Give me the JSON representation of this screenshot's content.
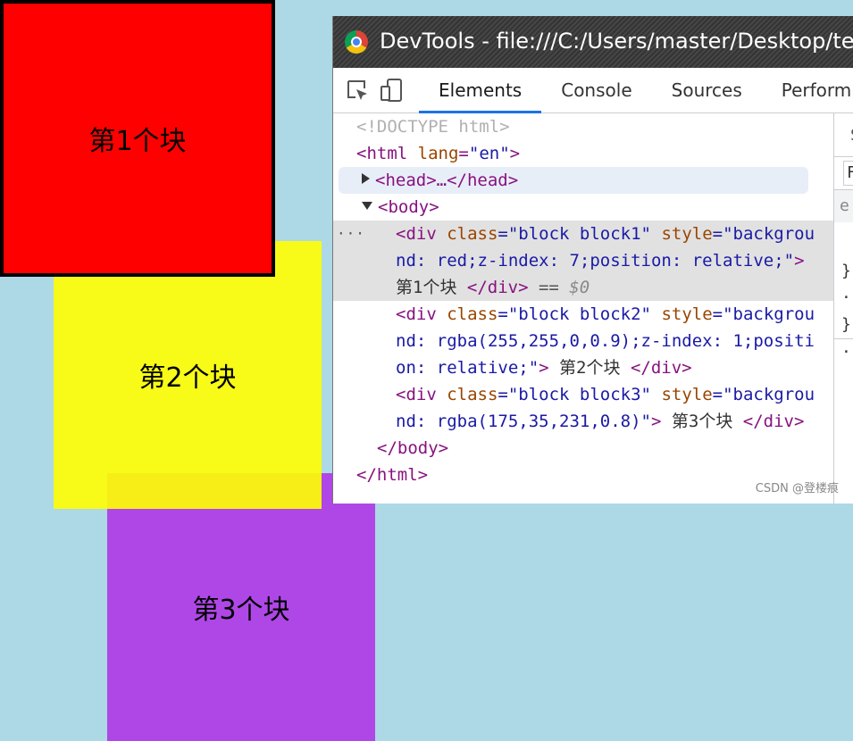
{
  "page": {
    "blocks": [
      {
        "label": "第1个块",
        "color": "#ff0000"
      },
      {
        "label": "第2个块",
        "color": "rgba(255,255,0,0.9)"
      },
      {
        "label": "第3个块",
        "color": "rgba(175,35,231,0.8)"
      }
    ]
  },
  "devtools": {
    "title": "DevTools - file:///C:/Users/master/Desktop/tes",
    "toolbar": {
      "inspect_icon": "inspect-element-icon",
      "device_icon": "device-toolbar-icon"
    },
    "tabs": [
      "Elements",
      "Console",
      "Sources",
      "Perform"
    ],
    "active_tab": "Elements",
    "dom": {
      "doctype": "<!DOCTYPE html>",
      "html_open_tag": "<html",
      "html_attr": "lang",
      "html_attr_value": "\"en\"",
      "html_close_bracket": ">",
      "head_collapsed": "<head>…</head>",
      "body_open": "<body>",
      "div1_line1_a": "<div ",
      "div1_line1_b": "class",
      "div1_line1_c": "=\"block block1\" ",
      "div1_line1_d": "style",
      "div1_line1_e": "=\"backgrou",
      "div1_line2": "nd: red;z-index: 7;position: relative;\"",
      "div1_line2_end": ">",
      "div1_text": "第1个块 ",
      "div1_close": "</div>",
      "div1_eq": " == ",
      "div1_sel": "$0",
      "div2_line1_a": "<div ",
      "div2_line1_b": "class",
      "div2_line1_c": "=\"block block2\" ",
      "div2_line1_d": "style",
      "div2_line1_e": "=\"backgrou",
      "div2_line2": "nd: rgba(255,255,0,0.9);z-index: 1;positi",
      "div2_line3": "on: relative;\"",
      "div2_line3_end": ">",
      "div2_text": " 第2个块 ",
      "div2_close": "</div>",
      "div3_line1_a": "<div ",
      "div3_line1_b": "class",
      "div3_line1_c": "=\"block block3\" ",
      "div3_line1_d": "style",
      "div3_line1_e": "=\"backgrou",
      "div3_line2": "nd: rgba(175,35,231,0.8)\"",
      "div3_line2_end": ">",
      "div3_text": " 第3个块 ",
      "div3_close": "</div>",
      "body_close": "</body>",
      "html_close": "</html>",
      "dots": "···"
    },
    "side": {
      "tab": "S",
      "filter": "F",
      "rule": "e",
      "brace1": "}",
      "dot1": "·",
      "brace2": "}",
      "dot2": "·"
    }
  },
  "watermark": "CSDN @登楼痕"
}
